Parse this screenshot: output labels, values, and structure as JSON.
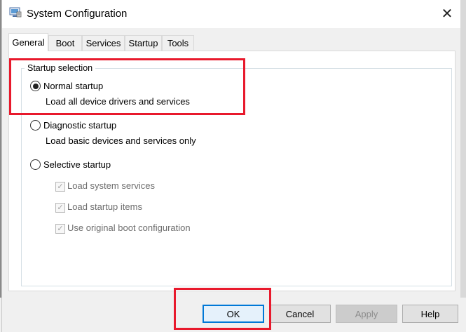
{
  "window": {
    "title": "System Configuration"
  },
  "tabs": [
    {
      "label": "General",
      "active": true
    },
    {
      "label": "Boot",
      "active": false
    },
    {
      "label": "Services",
      "active": false
    },
    {
      "label": "Startup",
      "active": false
    },
    {
      "label": "Tools",
      "active": false
    }
  ],
  "general": {
    "group_label": "Startup selection",
    "options": [
      {
        "label": "Normal startup",
        "description": "Load all device drivers and services",
        "selected": true
      },
      {
        "label": "Diagnostic startup",
        "description": "Load basic devices and services only",
        "selected": false
      },
      {
        "label": "Selective startup",
        "selected": false
      }
    ],
    "selective_items": [
      {
        "label": "Load system services",
        "checked": true,
        "enabled": false
      },
      {
        "label": "Load startup items",
        "checked": true,
        "enabled": false
      },
      {
        "label": "Use original boot configuration",
        "checked": true,
        "enabled": false
      }
    ]
  },
  "buttons": {
    "ok": "OK",
    "cancel": "Cancel",
    "apply": "Apply",
    "help": "Help"
  },
  "colors": {
    "highlight": "#e8192c",
    "default_button_border": "#0078d7"
  }
}
